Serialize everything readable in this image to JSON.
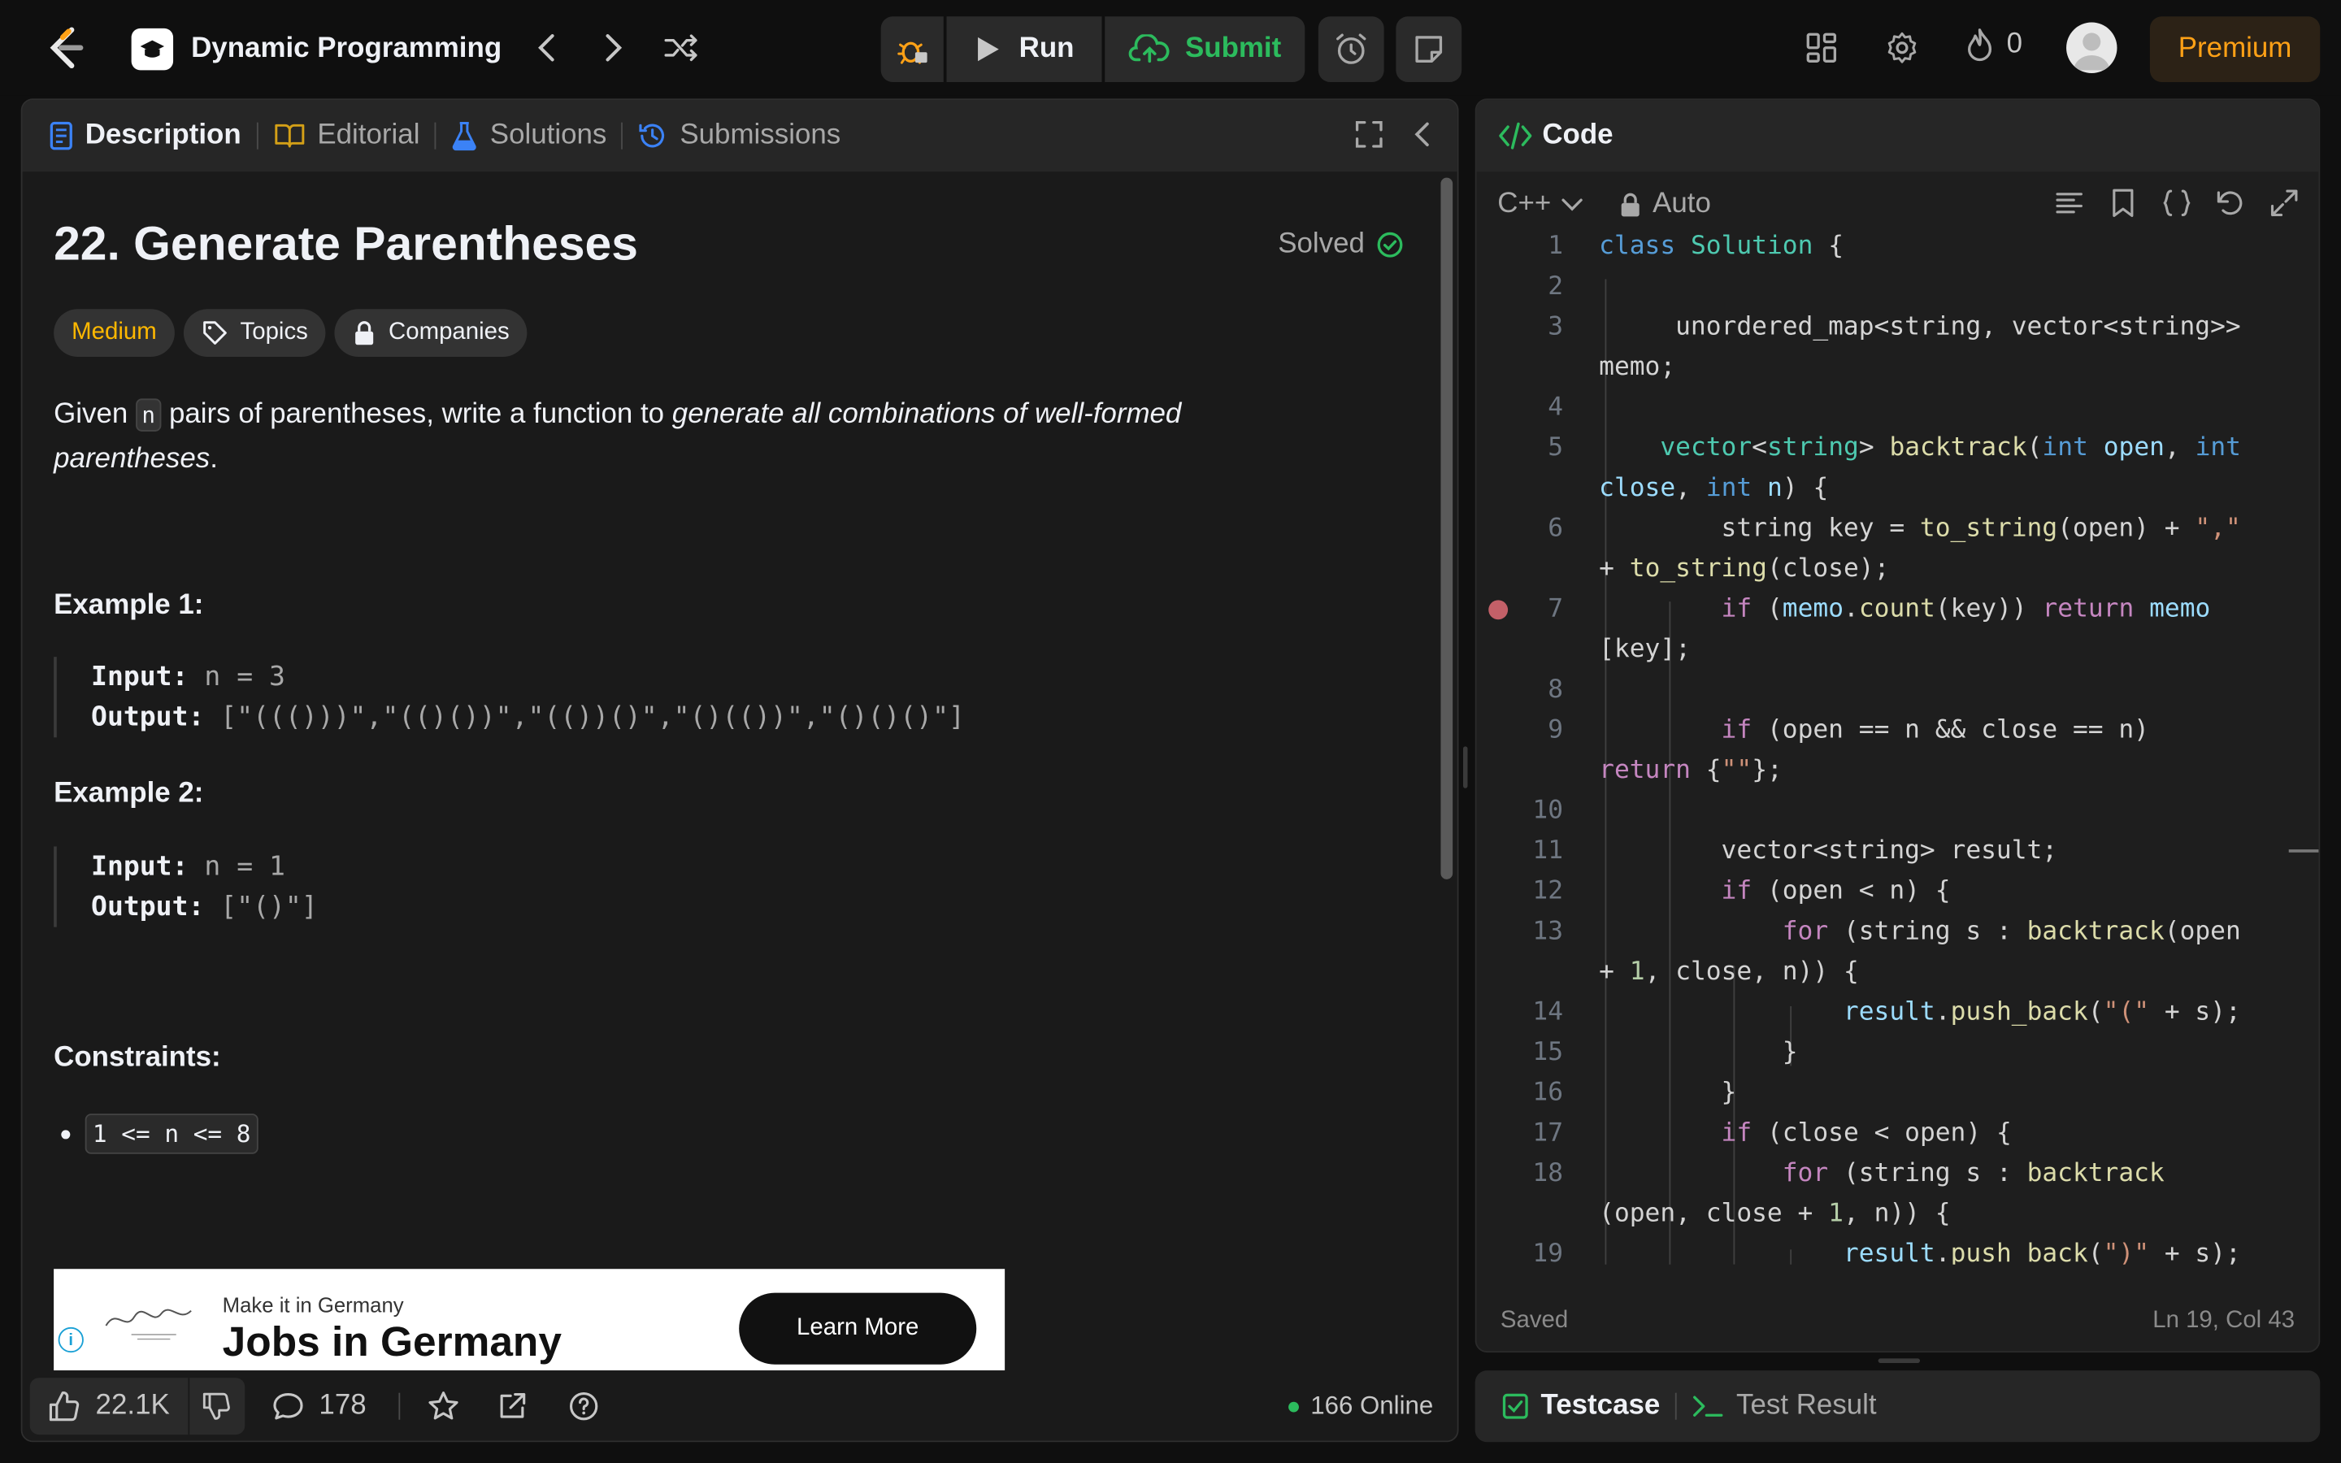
{
  "topbar": {
    "workspace_title": "Dynamic Programming",
    "run_label": "Run",
    "submit_label": "Submit",
    "streak_count": "0",
    "premium_label": "Premium"
  },
  "left": {
    "tabs": [
      {
        "label": "Description"
      },
      {
        "label": "Editorial"
      },
      {
        "label": "Solutions"
      },
      {
        "label": "Submissions"
      }
    ],
    "problem_title": "22. Generate Parentheses",
    "status": "Solved",
    "chips": {
      "difficulty": "Medium",
      "topics": "Topics",
      "companies": "Companies"
    },
    "description": {
      "p1": "Given ",
      "code": "n",
      "p2": " pairs of parentheses, write a function to ",
      "em": "generate all combinations of well-formed parentheses",
      "p3": "."
    },
    "example1": {
      "title": "Example 1:",
      "input_label": "Input:",
      "input_value": "n = 3",
      "output_label": "Output:",
      "output_value": "[\"((()))\",\"(()())\",\"(())()\",\"()(())\",\"()()()\"]"
    },
    "example2": {
      "title": "Example 2:",
      "input_label": "Input:",
      "input_value": "n = 1",
      "output_label": "Output:",
      "output_value": "[\"()\"]"
    },
    "constraints_title": "Constraints:",
    "constraint1": "1 <= n <= 8",
    "ad": {
      "small": "Make it in Germany",
      "big": "Jobs in Germany",
      "button": "Learn More"
    },
    "footer": {
      "likes": "22.1K",
      "comments": "178",
      "online": "166 Online"
    }
  },
  "right": {
    "title": "Code",
    "language": "C++",
    "mode": "Auto",
    "status_left": "Saved",
    "status_right": "Ln 19, Col 43"
  },
  "testpanel": {
    "tab1": "Testcase",
    "tab2": "Test Result"
  },
  "colors": {
    "accent": "#ffa116",
    "green": "#2cbb5d",
    "medium": "#ffb800"
  }
}
